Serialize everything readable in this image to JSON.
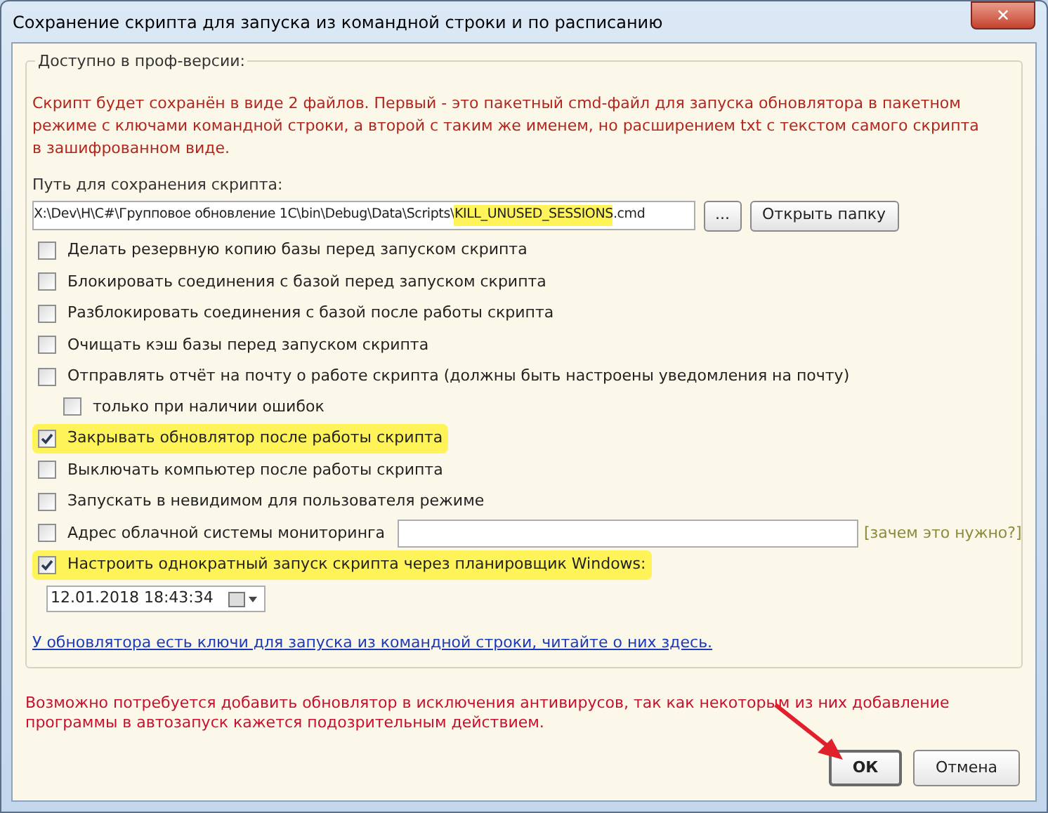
{
  "window": {
    "title": "Сохранение скрипта для запуска из командной строки и по расписанию",
    "close": "✕"
  },
  "group": {
    "title": "Доступно в проф-версии:",
    "notice": "Скрипт будет сохранён в виде 2 файлов. Первый - это пакетный cmd-файл для запуска обновлятора в пакетном режиме с ключами командной строки, а второй с таким же именем, но расширением txt с текстом самого скрипта в зашифрованном виде.",
    "path_label": "Путь для сохранения скрипта:",
    "path_parts": [
      {
        "text": "X:\\Dev\\H\\C#\\Групповое обновление 1С\\bin\\Debug\\Data\\Scripts\\",
        "highlighted": false
      },
      {
        "text": "KILL_UNUSED_SESSIONS",
        "highlighted": true
      },
      {
        "text": ".cmd",
        "highlighted": false
      }
    ],
    "browse_button": "...",
    "open_folder_button": "Открыть папку",
    "options": [
      {
        "kind": "checkbox",
        "label": "Делать резервную копию базы перед запуском скрипта",
        "checked": false,
        "highlighted": false
      },
      {
        "kind": "checkbox",
        "label": "Блокировать соединения с базой перед запуском скрипта",
        "checked": false,
        "highlighted": false
      },
      {
        "kind": "checkbox",
        "label": "Разблокировать соединения с базой после работы скрипта",
        "checked": false,
        "highlighted": false
      },
      {
        "kind": "checkbox",
        "label": "Очищать кэш базы перед запуском скрипта",
        "checked": false,
        "highlighted": false
      },
      {
        "kind": "checkbox",
        "label": "Отправлять отчёт на почту о работе скрипта (должны быть настроены уведомления на почту)",
        "checked": false,
        "highlighted": false,
        "children": [
          {
            "kind": "checkbox",
            "label": "только при наличии ошибок",
            "checked": false,
            "highlighted": false
          }
        ]
      },
      {
        "kind": "checkbox",
        "label": "Закрывать обновлятор после работы скрипта",
        "checked": true,
        "highlighted": true
      },
      {
        "kind": "checkbox",
        "label": "Выключать компьютер после работы скрипта",
        "checked": false,
        "highlighted": false
      },
      {
        "kind": "checkbox",
        "label": "Запускать в невидимом для пользователя режиме",
        "checked": false,
        "highlighted": false
      },
      {
        "kind": "checkbox_field",
        "label": "Адрес облачной системы мониторинга",
        "checked": false,
        "highlighted": false,
        "link": "[зачем это нужно?]"
      },
      {
        "kind": "checkbox",
        "label": "Настроить однократный запуск скрипта через планировщик Windows:",
        "checked": true,
        "highlighted": true
      }
    ],
    "datetime": "12.01.2018 18:43:34",
    "help_link": "У обновлятора есть ключи для запуска из командной строки, читайте о них здесь."
  },
  "warning": "Возможно потребуется добавить обновлятор в исключения антивирусов, так как некоторым из них добавление программы в автозапуск кажется подозрительным действием.",
  "buttons": [
    {
      "label": "ОК",
      "default": true
    },
    {
      "label": "Отмена",
      "default": false
    }
  ]
}
